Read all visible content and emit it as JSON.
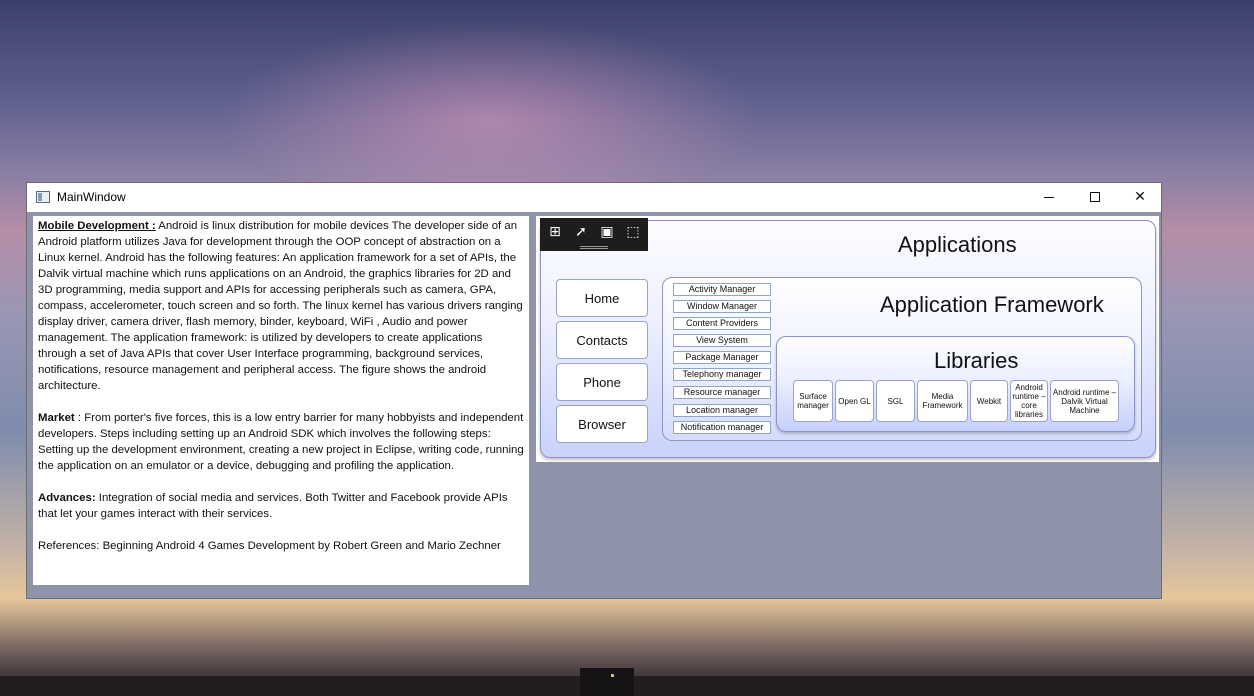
{
  "window": {
    "title": "MainWindow"
  },
  "controls": {
    "minimize": "—",
    "maximize": "☐",
    "close": "✕"
  },
  "text_panel": {
    "para1_heading": "Mobile Development :",
    "para1_body": "   Android is linux distribution for mobile devices  The developer side of  an Android platform utilizes Java for development through the OOP concept of abstraction on a Linux kernel.  Android has the following features: An application framework for a set of APIs, the Dalvik virtual machine which runs applications on an Android, the graphics libraries for 2D and 3D programming, media support and APIs for accessing peripherals such as camera, GPA, compass, accelerometer, touch screen and so forth.  The linux kernel has various drivers ranging display driver, camera driver, flash memory, binder, keyboard, WiFi , Audio and power management.  The application framework: is utilized by developers to create applications through a set of Java APIs that cover User Interface programming, background services, notifications, resource management and peripheral access. The figure shows the android architecture.",
    "para2_heading": "Market",
    "para2_body": " : From porter's five forces, this is a low entry barrier for many hobbyists and independent developers.   Steps including setting up an Android SDK which involves the following steps: Setting up the development environment, creating a new project in Eclipse, writing code, running the application on an emulator or a device, debugging and profiling the application.",
    "para3_heading": "Advances:",
    "para3_body": "   Integration of social media and services.  Both Twitter and Facebook provide APIs that let your games interact with their services.",
    "references": "References: Beginning Android 4 Games Development by Robert Green and Mario Zechner"
  },
  "toolbar": {
    "icons": [
      "select-element-icon",
      "pointer-icon",
      "frame-icon",
      "screenshot-select-icon"
    ]
  },
  "diagram": {
    "applications_title": "Applications",
    "apps": [
      "Home",
      "Contacts",
      "Phone",
      "Browser"
    ],
    "framework_title": "Application Framework",
    "managers": [
      "Activity Manager",
      "Window Manager",
      "Content Providers",
      "View System",
      "Package Manager",
      "Telephony manager",
      "Resource manager",
      "Location manager",
      "Notification manager"
    ],
    "libraries_title": "Libraries",
    "libraries": [
      "Surface manager",
      "Open GL",
      "SGL",
      "Media Framework",
      "Webkit",
      "Android runtime – core libraries",
      "Android runtime – Dalvik Virtual Machine"
    ]
  }
}
